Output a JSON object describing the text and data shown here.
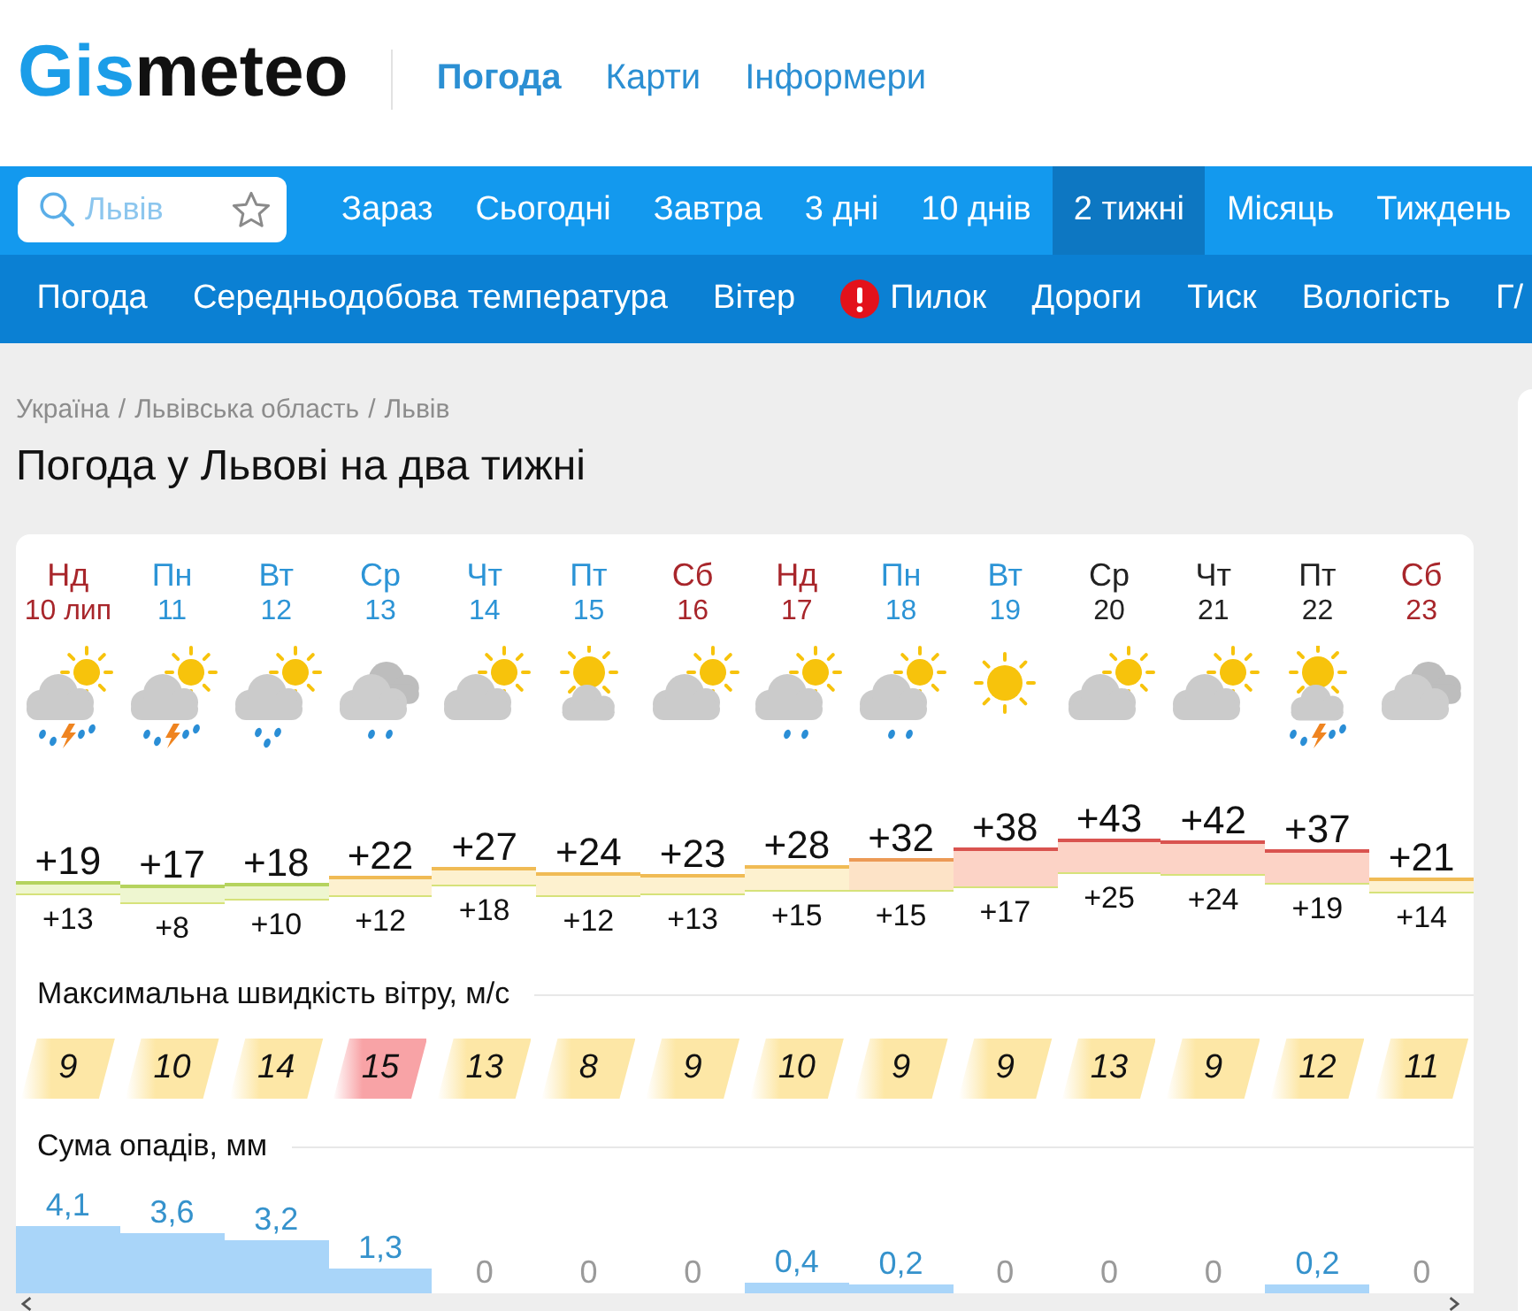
{
  "header": {
    "logo": {
      "accent": "Gis",
      "rest": "meteo"
    },
    "nav": [
      {
        "label": "Погода",
        "selected": true
      },
      {
        "label": "Карти",
        "selected": false
      },
      {
        "label": "Інформери",
        "selected": false
      }
    ]
  },
  "search": {
    "placeholder": "Львів"
  },
  "period_tabs": [
    {
      "label": "Зараз",
      "selected": false
    },
    {
      "label": "Сьогодні",
      "selected": false
    },
    {
      "label": "Завтра",
      "selected": false
    },
    {
      "label": "3 дні",
      "selected": false
    },
    {
      "label": "10 днів",
      "selected": false
    },
    {
      "label": "2 тижні",
      "selected": true
    },
    {
      "label": "Місяць",
      "selected": false
    },
    {
      "label": "Тиждень",
      "selected": false
    }
  ],
  "section_links": [
    {
      "label": "Погода",
      "alert": false
    },
    {
      "label": "Середньодобова температура",
      "alert": false
    },
    {
      "label": "Вітер",
      "alert": false
    },
    {
      "label": "Пилок",
      "alert": true
    },
    {
      "label": "Дороги",
      "alert": false
    },
    {
      "label": "Тиск",
      "alert": false
    },
    {
      "label": "Вологість",
      "alert": false
    },
    {
      "label": "Г/",
      "alert": false
    }
  ],
  "breadcrumb": [
    {
      "kind": "link",
      "label": "Україна"
    },
    {
      "kind": "separator",
      "label": "/"
    },
    {
      "kind": "link",
      "label": "Львівська область"
    },
    {
      "kind": "separator",
      "label": "/"
    },
    {
      "kind": "link",
      "label": "Львів"
    }
  ],
  "title": "Погода у Львові на два тижні",
  "forecast": {
    "days": [
      {
        "day": "Нд",
        "date": "10 лип",
        "color": "#a8262b",
        "kind": "storm",
        "high": "+19",
        "low": "+13"
      },
      {
        "day": "Пн",
        "date": "11",
        "color": "#2c94d6",
        "kind": "storm",
        "high": "+17",
        "low": "+8"
      },
      {
        "day": "Вт",
        "date": "12",
        "color": "#2c94d6",
        "kind": "showers",
        "high": "+18",
        "low": "+10"
      },
      {
        "day": "Ср",
        "date": "13",
        "color": "#2c94d6",
        "kind": "drizzle",
        "high": "+22",
        "low": "+12"
      },
      {
        "day": "Чт",
        "date": "14",
        "color": "#2c94d6",
        "kind": "partly",
        "high": "+27",
        "low": "+18"
      },
      {
        "day": "Пт",
        "date": "15",
        "color": "#2c94d6",
        "kind": "fair",
        "high": "+24",
        "low": "+12"
      },
      {
        "day": "Сб",
        "date": "16",
        "color": "#a8262b",
        "kind": "partly",
        "high": "+23",
        "low": "+13"
      },
      {
        "day": "Нд",
        "date": "17",
        "color": "#a8262b",
        "kind": "sprinkle",
        "high": "+28",
        "low": "+15"
      },
      {
        "day": "Пн",
        "date": "18",
        "color": "#2c94d6",
        "kind": "sprinkle",
        "high": "+32",
        "low": "+15"
      },
      {
        "day": "Вт",
        "date": "19",
        "color": "#2c94d6",
        "kind": "clear",
        "high": "+38",
        "low": "+17"
      },
      {
        "day": "Ср",
        "date": "20",
        "color": "#222222",
        "kind": "partly",
        "high": "+43",
        "low": "+25"
      },
      {
        "day": "Чт",
        "date": "21",
        "color": "#222222",
        "kind": "partly",
        "high": "+42",
        "low": "+24"
      },
      {
        "day": "Пт",
        "date": "22",
        "color": "#222222",
        "kind": "sunstorm",
        "high": "+37",
        "low": "+19"
      },
      {
        "day": "Сб",
        "date": "23",
        "color": "#a8262b",
        "kind": "overcast",
        "high": "+21",
        "low": "+14"
      }
    ],
    "wind": {
      "heading": "Максимальна швидкість вітру, м/с",
      "values": [
        {
          "value": "9",
          "color": "#fde7a6"
        },
        {
          "value": "10",
          "color": "#fde7a6"
        },
        {
          "value": "14",
          "color": "#fde7a6"
        },
        {
          "value": "15",
          "color": "#f8a3a6"
        },
        {
          "value": "13",
          "color": "#fde7a6"
        },
        {
          "value": "8",
          "color": "#fde7a6"
        },
        {
          "value": "9",
          "color": "#fde7a6"
        },
        {
          "value": "10",
          "color": "#fde7a6"
        },
        {
          "value": "9",
          "color": "#fde7a6"
        },
        {
          "value": "9",
          "color": "#fde7a6"
        },
        {
          "value": "13",
          "color": "#fde7a6"
        },
        {
          "value": "9",
          "color": "#fde7a6"
        },
        {
          "value": "12",
          "color": "#fde7a6"
        },
        {
          "value": "11",
          "color": "#fde7a6"
        }
      ]
    },
    "precipitation": {
      "heading": "Сума опадів, мм",
      "values": [
        "4,1",
        "3,6",
        "3,2",
        "1,3",
        "0",
        "0",
        "0",
        "0,4",
        "0,2",
        "0",
        "0",
        "0",
        "0,2",
        "0"
      ]
    }
  }
}
